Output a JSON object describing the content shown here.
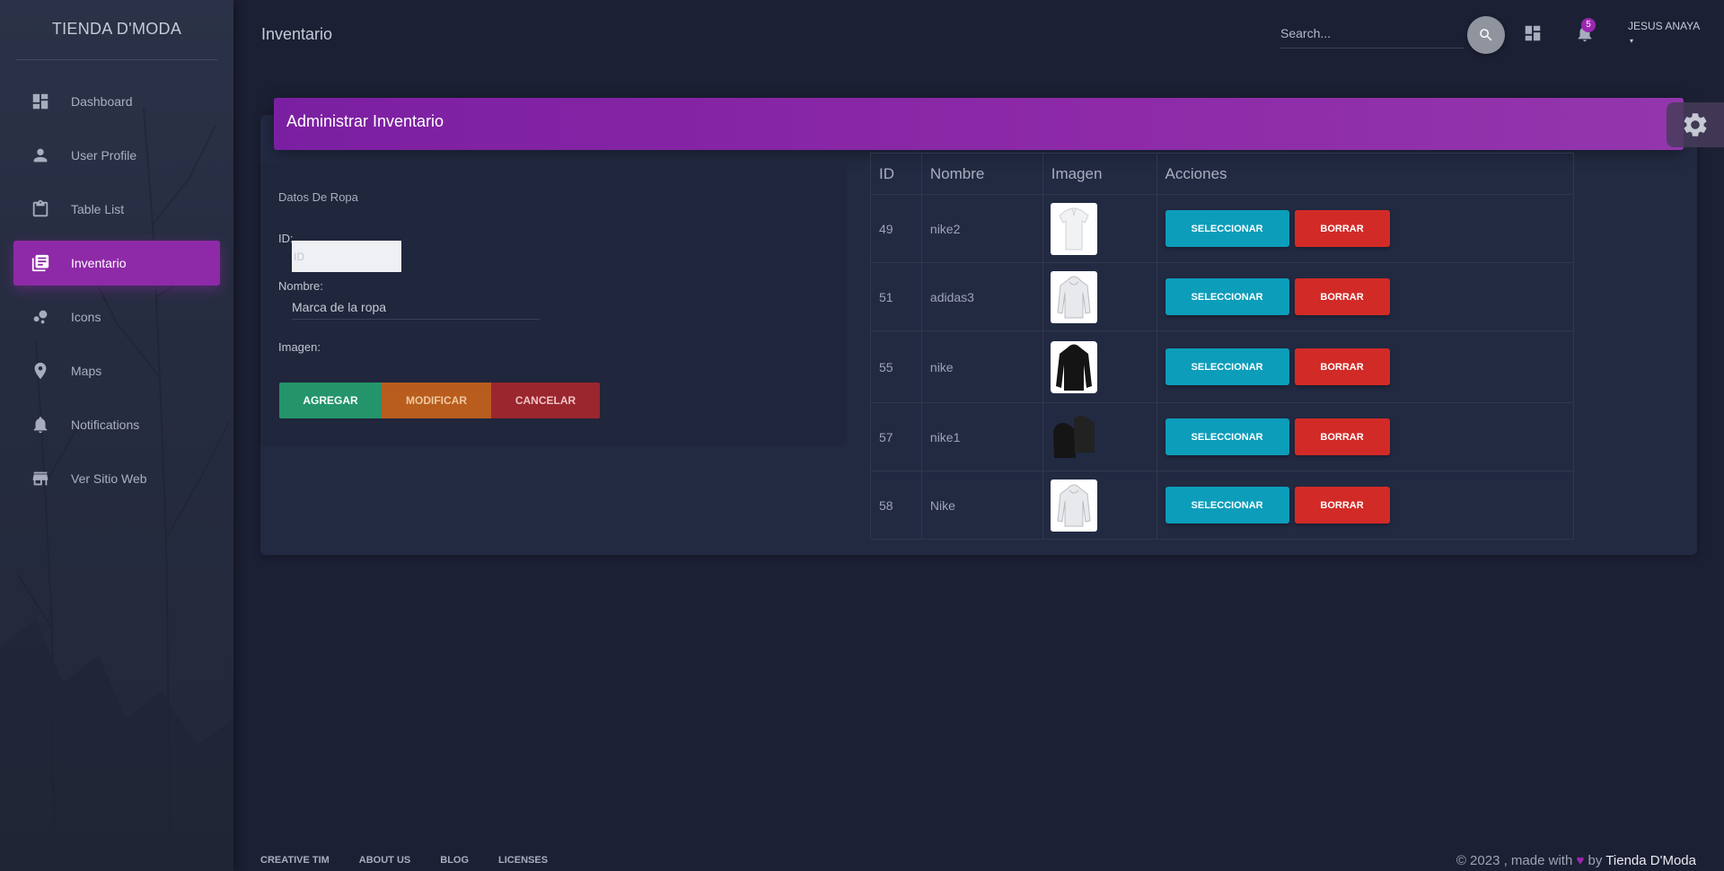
{
  "app": {
    "brand": "TIENDA D'MODA",
    "page_title": "Inventario"
  },
  "sidebar": {
    "items": [
      {
        "label": "Dashboard",
        "icon": "dashboard-icon",
        "active": false
      },
      {
        "label": "User Profile",
        "icon": "person-icon",
        "active": false
      },
      {
        "label": "Table List",
        "icon": "clipboard-icon",
        "active": false
      },
      {
        "label": "Inventario",
        "icon": "library-books-icon",
        "active": true
      },
      {
        "label": "Icons",
        "icon": "bubble-chart-icon",
        "active": false
      },
      {
        "label": "Maps",
        "icon": "location-pin-icon",
        "active": false
      },
      {
        "label": "Notifications",
        "icon": "bell-icon",
        "active": false
      },
      {
        "label": "Ver Sitio Web",
        "icon": "store-icon",
        "active": false
      }
    ]
  },
  "topbar": {
    "search_placeholder": "Search...",
    "notification_count": "5",
    "user_name": "JESUS ANAYA",
    "user_caret": "▾"
  },
  "card": {
    "title": "Administrar Inventario"
  },
  "form": {
    "section_title": "Datos De Ropa",
    "id_label": "ID:",
    "id_placeholder": "ID",
    "nombre_label": "Nombre:",
    "nombre_placeholder": "Marca de la ropa",
    "imagen_label": "Imagen:",
    "buttons": {
      "agregar": "AGREGAR",
      "modificar": "MODIFICAR",
      "cancelar": "CANCELAR"
    }
  },
  "table": {
    "headers": [
      "ID",
      "Nombre",
      "Imagen",
      "Acciones"
    ],
    "select_label": "SELECCIONAR",
    "delete_label": "BORRAR",
    "rows": [
      {
        "id": "49",
        "nombre": "nike2",
        "image": "white-polo-shirt"
      },
      {
        "id": "51",
        "nombre": "adidas3",
        "image": "white-hoodie"
      },
      {
        "id": "55",
        "nombre": "nike",
        "image": "black-hoodie"
      },
      {
        "id": "57",
        "nombre": "nike1",
        "image": "black-jacket-pair"
      },
      {
        "id": "58",
        "nombre": "Nike",
        "image": "white-hoodie"
      }
    ]
  },
  "footer": {
    "links": [
      "CREATIVE TIM",
      "ABOUT US",
      "BLOG",
      "LICENSES"
    ],
    "copyright_prefix": "© 2023 , made with",
    "heart": "♥",
    "by": "by",
    "copyright_brand": "Tienda D'Moda"
  },
  "colors": {
    "accent": "#8e2aa8",
    "background": "#1c2034",
    "agregar": "#24946a",
    "modificar": "#b85d1e",
    "cancelar": "#9a262e",
    "seleccionar": "#0c9dbb",
    "borrar": "#d22b27"
  }
}
